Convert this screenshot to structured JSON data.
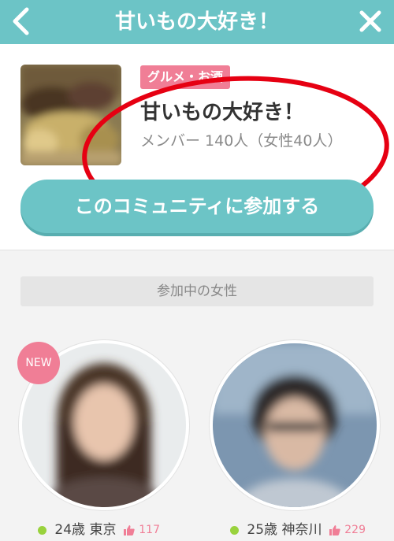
{
  "header": {
    "title": "甘いもの大好き！",
    "back_icon": "chevron-left-icon",
    "close_icon": "close-icon"
  },
  "community": {
    "category": "グルメ・お酒",
    "name": "甘いもの大好き！",
    "members": "メンバー 140人（女性40人）",
    "join_label": "このコミュニティに参加する"
  },
  "section": {
    "title": "参加中の女性"
  },
  "profiles": [
    {
      "new_label": "NEW",
      "age": "24歳",
      "location": "東京",
      "likes": "117",
      "online": true
    },
    {
      "age": "25歳",
      "location": "神奈川",
      "likes": "229",
      "online": true
    }
  ],
  "colors": {
    "accent": "#6cc4c6",
    "pink": "#f07e96",
    "online": "#99d23d",
    "highlight": "#e60012"
  }
}
